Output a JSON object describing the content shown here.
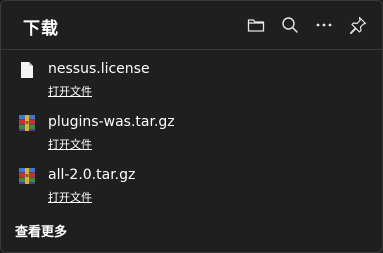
{
  "header": {
    "title": "下载",
    "icons": [
      "folder-icon",
      "search-icon",
      "more-icon",
      "pin-icon"
    ]
  },
  "downloads": [
    {
      "filename": "nessus.license",
      "action": "打开文件",
      "icon": "document-icon"
    },
    {
      "filename": "plugins-was.tar.gz",
      "action": "打开文件",
      "icon": "archive-icon"
    },
    {
      "filename": "all-2.0.tar.gz",
      "action": "打开文件",
      "icon": "archive-icon"
    }
  ],
  "footer": {
    "more_label": "查看更多"
  },
  "colors": {
    "background": "#1f1f1f",
    "text": "#ffffff",
    "divider": "#383838"
  }
}
